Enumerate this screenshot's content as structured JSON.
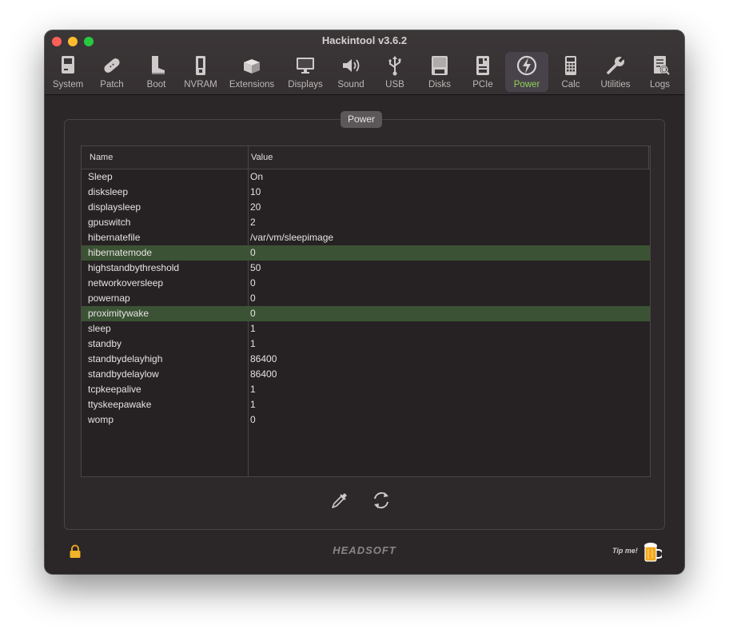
{
  "window": {
    "title": "Hackintool v3.6.2"
  },
  "toolbar": {
    "items": [
      {
        "label": "System",
        "icon": "system-icon"
      },
      {
        "label": "Patch",
        "icon": "patch-icon"
      },
      {
        "label": "Boot",
        "icon": "boot-icon"
      },
      {
        "label": "NVRAM",
        "icon": "nvram-icon"
      },
      {
        "label": "Extensions",
        "icon": "extensions-icon"
      },
      {
        "label": "Displays",
        "icon": "displays-icon"
      },
      {
        "label": "Sound",
        "icon": "sound-icon"
      },
      {
        "label": "USB",
        "icon": "usb-icon"
      },
      {
        "label": "Disks",
        "icon": "disks-icon"
      },
      {
        "label": "PCIe",
        "icon": "pcie-icon"
      },
      {
        "label": "Power",
        "icon": "power-icon",
        "active": true
      },
      {
        "label": "Calc",
        "icon": "calc-icon"
      },
      {
        "label": "Utilities",
        "icon": "utilities-icon"
      },
      {
        "label": "Logs",
        "icon": "logs-icon"
      }
    ],
    "active_color": "#8fd255"
  },
  "power": {
    "group_title": "Power",
    "columns": {
      "name": "Name",
      "value": "Value"
    },
    "rows": [
      {
        "name": "Sleep",
        "value": "On"
      },
      {
        "name": "disksleep",
        "value": "10"
      },
      {
        "name": "displaysleep",
        "value": "20"
      },
      {
        "name": "gpuswitch",
        "value": "2"
      },
      {
        "name": "hibernatefile",
        "value": "/var/vm/sleepimage"
      },
      {
        "name": "hibernatemode",
        "value": "0",
        "highlight": true
      },
      {
        "name": "highstandbythreshold",
        "value": "50"
      },
      {
        "name": "networkoversleep",
        "value": "0"
      },
      {
        "name": "powernap",
        "value": "0"
      },
      {
        "name": "proximitywake",
        "value": "0",
        "highlight": true
      },
      {
        "name": "sleep",
        "value": "1"
      },
      {
        "name": "standby",
        "value": "1"
      },
      {
        "name": "standbydelayhigh",
        "value": "86400"
      },
      {
        "name": "standbydelaylow",
        "value": "86400"
      },
      {
        "name": "tcpkeepalive",
        "value": "1"
      },
      {
        "name": "ttyskeepawake",
        "value": "1"
      },
      {
        "name": "womp",
        "value": "0"
      }
    ],
    "highlight_color": "#3b5334",
    "actions": [
      {
        "name": "edit-button",
        "icon": "pipette-icon"
      },
      {
        "name": "refresh-button",
        "icon": "refresh-icon"
      }
    ]
  },
  "footer": {
    "lock_icon": "lock-icon",
    "brand": "HEADSOFT",
    "tip_label": "Tip me!",
    "tip_icon": "beer-icon"
  }
}
